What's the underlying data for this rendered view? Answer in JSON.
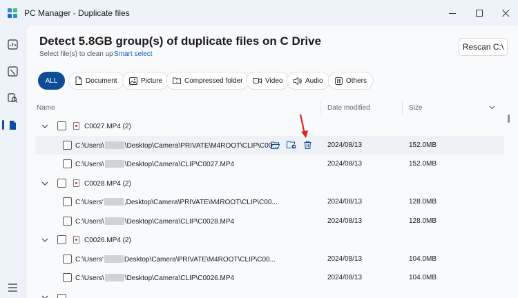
{
  "window": {
    "title": "PC Manager - Duplicate files"
  },
  "header": {
    "headline": "Detect 5.8GB group(s) of duplicate files on C Drive",
    "subline": "Select file(s) to clean up",
    "smart_select": "Smart select",
    "rescan": "Rescan C:\\"
  },
  "filters": [
    {
      "label": "ALL",
      "active": true
    },
    {
      "label": "Document",
      "icon": "document-icon"
    },
    {
      "label": "Picture",
      "icon": "picture-icon"
    },
    {
      "label": "Compressed folder",
      "icon": "compressed-folder-icon"
    },
    {
      "label": "Video",
      "icon": "video-icon"
    },
    {
      "label": "Audio",
      "icon": "audio-icon"
    },
    {
      "label": "Others",
      "icon": "others-icon"
    }
  ],
  "table": {
    "columns": {
      "name": "Name",
      "date": "Date modified",
      "size": "Size"
    },
    "groups": [
      {
        "name": "C0027.MP4 (2)",
        "files": [
          {
            "path_start": "C:\\Users\\",
            "path_end": "\\Desktop\\Camera\\PRIVATE\\M4ROOT\\CLIP\\C00...",
            "date": "2024/08/13",
            "size": "152.0MB",
            "hover": true
          },
          {
            "path_start": "C:\\Users\\",
            "path_end": "\\Desktop\\Camera\\CLIP\\C0027.MP4",
            "date": "2024/08/13",
            "size": "152.0MB"
          }
        ]
      },
      {
        "name": "C0028.MP4 (2)",
        "files": [
          {
            "path_start": "C:\\Users'",
            "path_end": ",Desktop\\Camera\\PRIVATE\\M4ROOT\\CLIP\\C00...",
            "date": "2024/08/13",
            "size": "128.0MB"
          },
          {
            "path_start": "C:\\Users\\",
            "path_end": "\\Desktop\\Camera\\CLIP\\C0028.MP4",
            "date": "2024/08/13",
            "size": "128.0MB"
          }
        ]
      },
      {
        "name": "C0026.MP4 (2)",
        "files": [
          {
            "path_start": "C:\\Users'",
            "path_end": "Desktop\\Camera\\PRIVATE\\M4ROOT\\CLIP\\C00...",
            "date": "2024/08/13",
            "size": "104.0MB"
          },
          {
            "path_start": "C:\\Users\\",
            "path_end": "\\Desktop\\Camera\\CLIP\\C0026.MP4",
            "date": "2024/08/13",
            "size": "104.0MB"
          }
        ]
      }
    ]
  },
  "annotation": {
    "arrow_color": "#e3201b"
  },
  "colors": {
    "accent": "#0f4c97",
    "link": "#0f5fb5"
  }
}
